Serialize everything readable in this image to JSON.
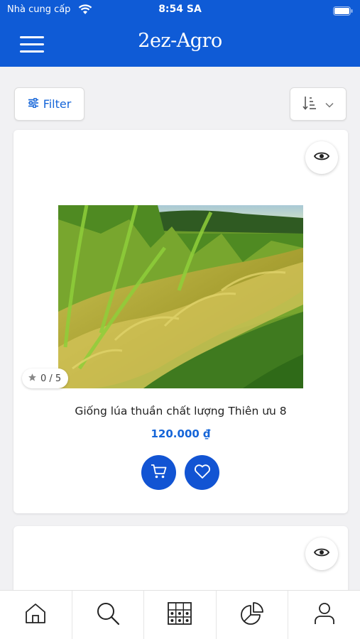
{
  "status_bar": {
    "carrier": "Nhà cung cấp",
    "time": "8:54 SA"
  },
  "header": {
    "title": "2ez-Agro",
    "menu_icon": "hamburger-menu-icon"
  },
  "toolbar": {
    "filter_label": "Filter",
    "filter_icon": "sliders-icon",
    "sort_icon": "sort-descending-icon",
    "sort_dropdown_icon": "chevron-down-icon"
  },
  "products": [
    {
      "name": "Giống lúa thuần chất lượng Thiên ưu 8",
      "price": "120.000 ₫",
      "rating": "0 / 5",
      "image": "rice-field-photo"
    }
  ],
  "tabs": [
    {
      "name": "home",
      "icon": "home-icon"
    },
    {
      "name": "search",
      "icon": "search-icon"
    },
    {
      "name": "store",
      "icon": "store-icon"
    },
    {
      "name": "statistics",
      "icon": "pie-chart-icon"
    },
    {
      "name": "account",
      "icon": "user-icon"
    }
  ],
  "colors": {
    "primary": "#0f5bd6",
    "accent_text": "#1565d8",
    "action_button": "#1254d3"
  }
}
